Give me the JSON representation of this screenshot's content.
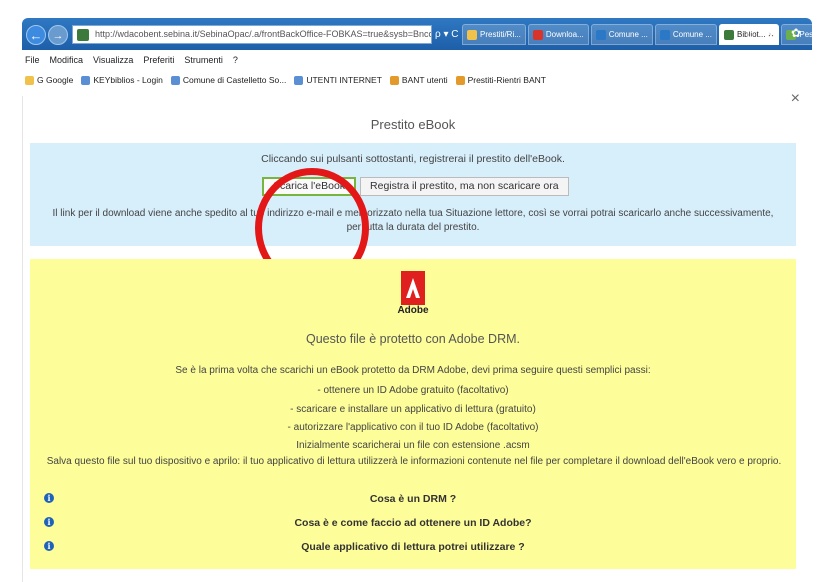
{
  "browser": {
    "address_url": "http://wdacobent.sebina.it/SebinaOpac/.a/frontBackOffice-FOBKAS=true&sysb=Bnconte",
    "address_tools": "ρ ▾ C",
    "tabs": [
      {
        "label": "Prestiti/Ri...",
        "color": "#f0c14b"
      },
      {
        "label": "Downloa...",
        "color": "#d8342b"
      },
      {
        "label": "Comune ...",
        "color": "#2b78c6"
      },
      {
        "label": "Comune ...",
        "color": "#2b78c6"
      },
      {
        "label": "Bibliot... ✕",
        "color": "#3c7a3b"
      },
      {
        "label": "Pesto - c...",
        "color": "#6bb04c"
      }
    ],
    "window_tools": "⌂ ★ ✿"
  },
  "menubar": {
    "items": [
      "File",
      "Modifica",
      "Visualizza",
      "Preferiti",
      "Strumenti",
      "?"
    ]
  },
  "favorites": {
    "items": [
      {
        "label": "G Google",
        "color": "#f0c14b"
      },
      {
        "label": "KEYbiblios - Login",
        "color": "#5b8fd4"
      },
      {
        "label": "Comune di Castelletto So...",
        "color": "#5b8fd4"
      },
      {
        "label": "UTENTI INTERNET",
        "color": "#5b8fd4"
      },
      {
        "label": "BANT utenti",
        "color": "#e39a2b"
      },
      {
        "label": "Prestiti-Rientri BANT",
        "color": "#e39a2b"
      }
    ]
  },
  "dialog": {
    "close": "×",
    "title": "Prestito eBook",
    "info": {
      "intro": "Cliccando sui pulsanti sottostanti, registrerai il prestito dell'eBook.",
      "download_button": "Scarica l'eBook",
      "register_button": "Registra il prestito, ma non scaricare ora",
      "note": "Il link per il download viene anche spedito al tuo indirizzo e-mail e memorizzato nella tua Situazione lettore, così se vorrai potrai scaricarlo anche successivamente, per tutta la durata del prestito."
    },
    "drm": {
      "logo_text": "Adobe",
      "heading": "Questo file è protetto con Adobe DRM.",
      "lines": [
        "Se è la prima volta che scarichi un eBook protetto da DRM Adobe, devi prima seguire questi semplici passi:",
        "- ottenere un ID Adobe gratuito (facoltativo)",
        "- scaricare e installare un applicativo di lettura (gratuito)",
        "- autorizzare l'applicativo con il tuo ID Adobe (facoltativo)",
        "Inizialmente scaricherai un file con estensione .acsm"
      ],
      "save_note": "Salva questo file sul tuo dispositivo e aprilo: il tuo applicativo di lettura utilizzerà le informazioni contenute nel file per completare il download dell'eBook vero e proprio.",
      "faqs": [
        "Cosa è un DRM ?",
        "Cosa è e come faccio ad ottenere un ID Adobe?",
        "Quale applicativo di lettura potrei utilizzare ?"
      ]
    }
  },
  "colors": {
    "info_bg": "#d7eefb",
    "drm_bg": "#fdfd9a",
    "highlight": "#e31717",
    "primary_border": "#79b43e"
  }
}
